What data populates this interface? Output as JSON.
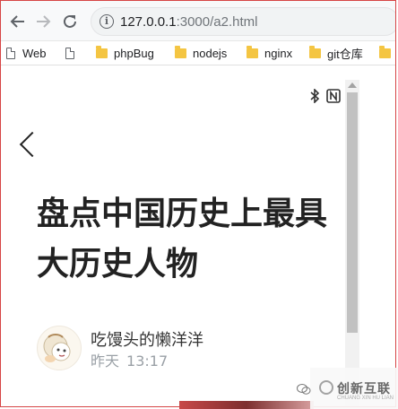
{
  "browser": {
    "url_host": "127.0.0.1",
    "url_path": ":3000/a2.html",
    "bookmarks": [
      {
        "label": "Web",
        "icon": "page-icon"
      },
      {
        "label": "phpBug",
        "icon": "folder-icon"
      },
      {
        "label": "nodejs",
        "icon": "folder-icon"
      },
      {
        "label": "nginx",
        "icon": "folder-icon"
      },
      {
        "label": "git仓库",
        "icon": "folder-icon"
      }
    ]
  },
  "status_bar": {
    "icons": "bluetooth-icon nfc-icon"
  },
  "article": {
    "title": "盘点中国历史上最具大历史人物",
    "author": "吃馒头的懒洋洋",
    "date_label": "昨天",
    "time": "13:17"
  },
  "watermark": {
    "brand": "创新互联",
    "sub": "CHUANG XIN HU LIAN"
  },
  "colors": {
    "frame_border": "#d64545",
    "folder": "#f4c542"
  }
}
